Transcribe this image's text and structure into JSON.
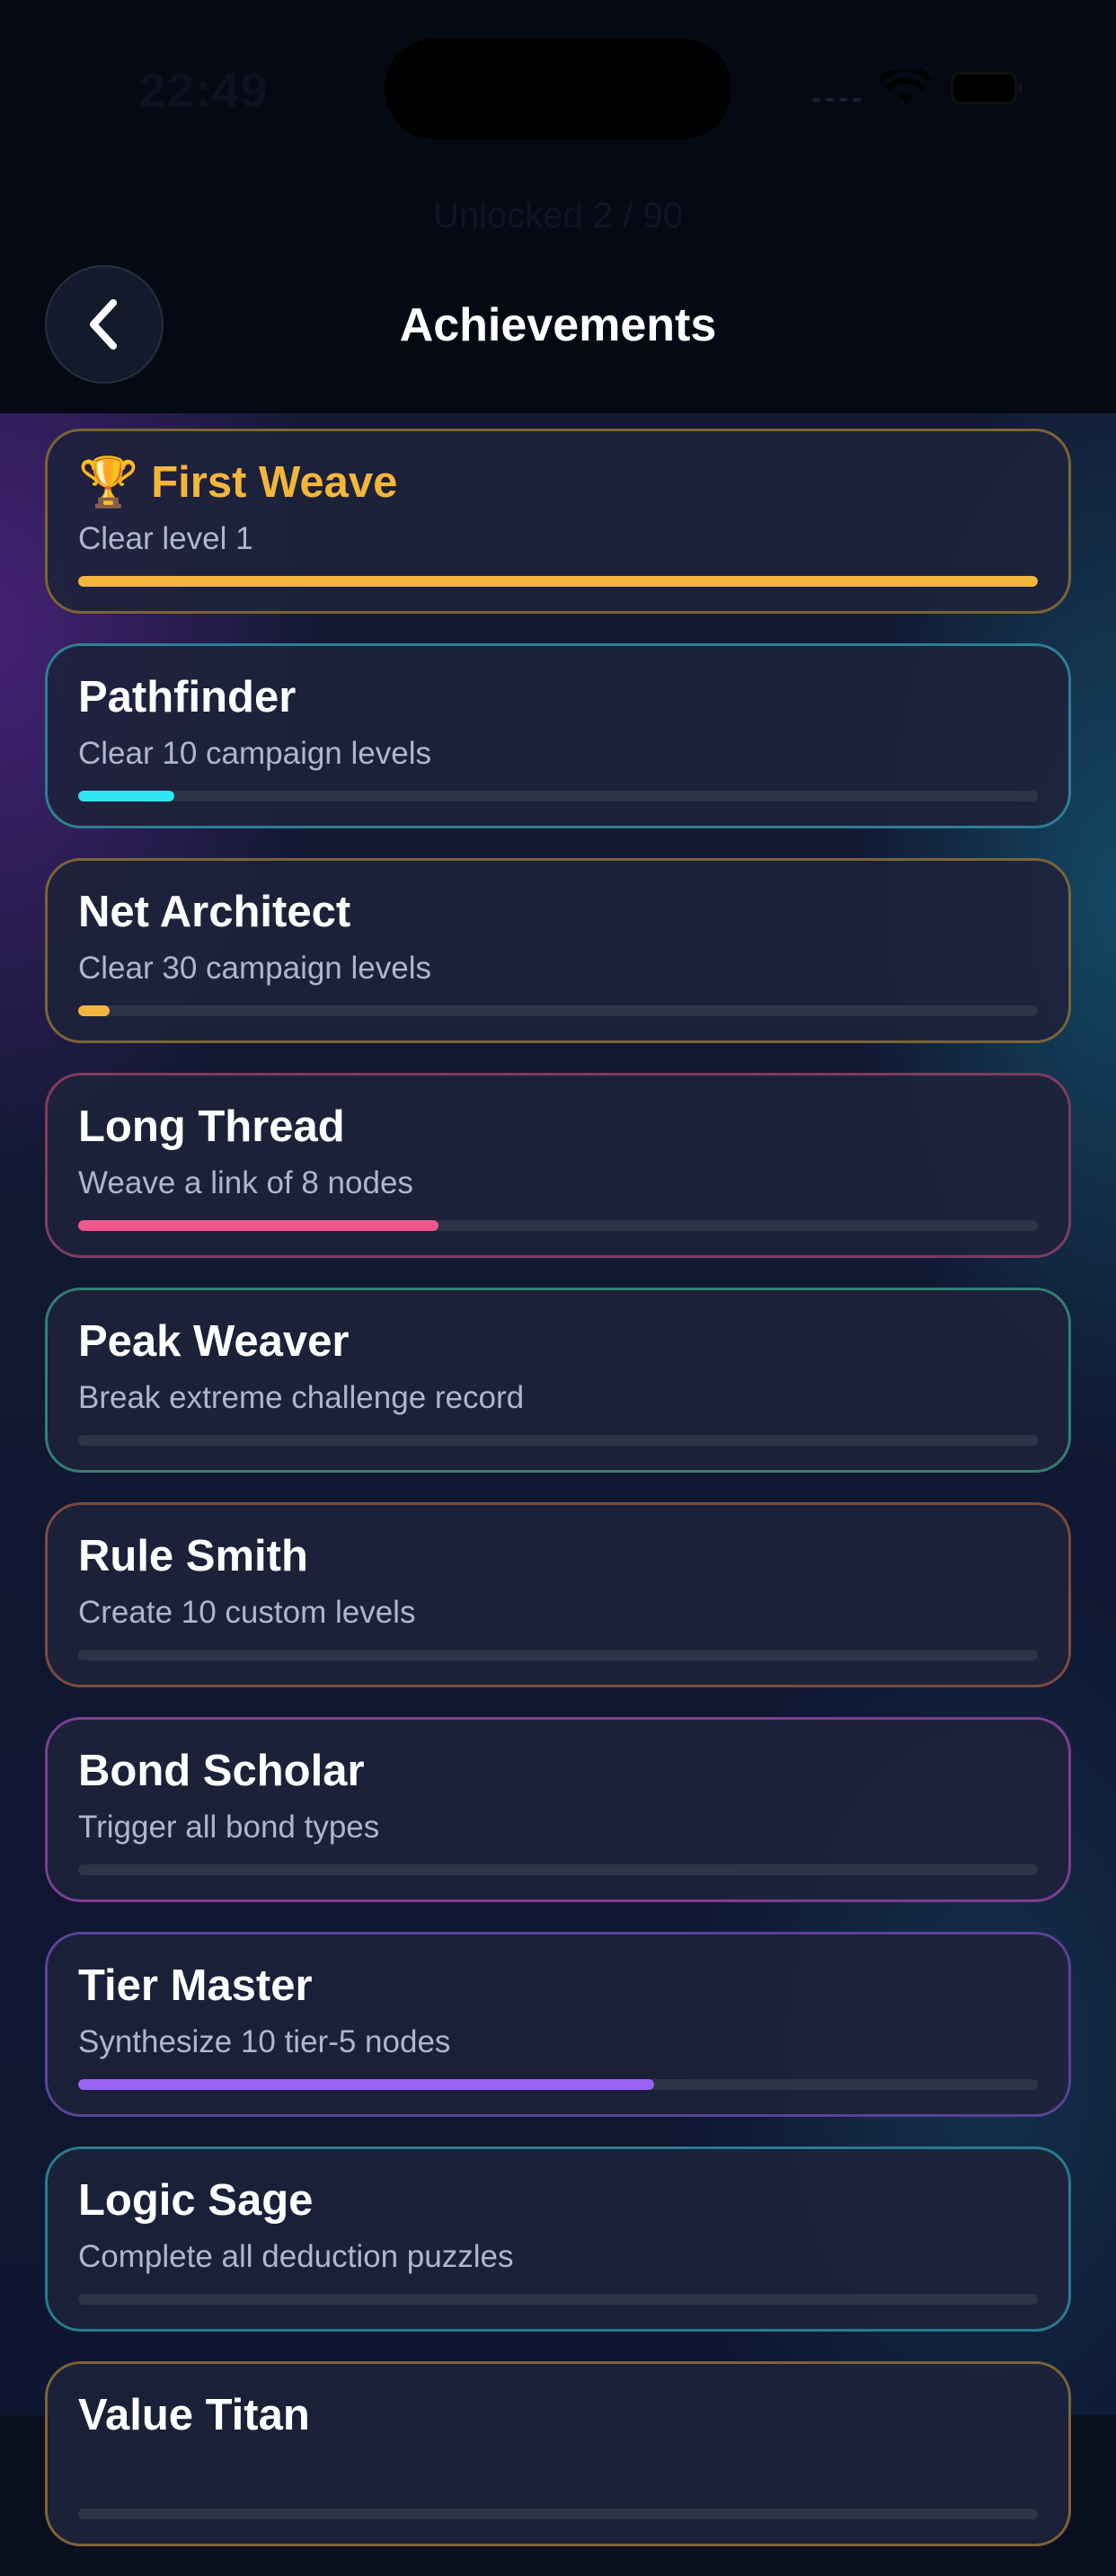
{
  "status_bar": {
    "time": "22:49"
  },
  "header": {
    "unlocked_text": "Unlocked 2 / 90",
    "title": "Achievements",
    "back_icon": "chevron-left-icon"
  },
  "achievements": [
    {
      "title": "First Weave",
      "desc": "Clear level 1",
      "progress": 1.0,
      "color": "#f4b63a",
      "border": "#7a6435",
      "unlocked": true,
      "icon": "trophy-icon"
    },
    {
      "title": "Pathfinder",
      "desc": "Clear 10 campaign levels",
      "progress": 0.1,
      "color": "#2ee6f2",
      "border": "#2c7f93",
      "unlocked": false
    },
    {
      "title": "Net Architect",
      "desc": "Clear 30 campaign levels",
      "progress": 0.033,
      "color": "#f4b63a",
      "border": "#7a6435",
      "unlocked": false
    },
    {
      "title": "Long Thread",
      "desc": "Weave a link of 8 nodes",
      "progress": 0.375,
      "color": "#f0578f",
      "border": "#7d3d60",
      "unlocked": false
    },
    {
      "title": "Peak Weaver",
      "desc": "Break extreme challenge record",
      "progress": 0.0,
      "color": "#37c89a",
      "border": "#2f7f72",
      "unlocked": false
    },
    {
      "title": "Rule Smith",
      "desc": "Create 10 custom levels",
      "progress": 0.0,
      "color": "#e8734a",
      "border": "#7c4a3e",
      "unlocked": false
    },
    {
      "title": "Bond Scholar",
      "desc": "Trigger all bond types",
      "progress": 0.0,
      "color": "#c85ae0",
      "border": "#7a3f8f",
      "unlocked": false
    },
    {
      "title": "Tier Master",
      "desc": "Synthesize 10 tier-5 nodes",
      "progress": 0.6,
      "color": "#9a62f5",
      "border": "#5a4296",
      "unlocked": false
    },
    {
      "title": "Logic Sage",
      "desc": "Complete all deduction puzzles",
      "progress": 0.0,
      "color": "#2bc9d8",
      "border": "#2a7a8e",
      "unlocked": false
    },
    {
      "title": "Value Titan",
      "desc": "",
      "progress": 0.0,
      "color": "#f4b63a",
      "border": "#7a6435",
      "unlocked": false
    }
  ]
}
